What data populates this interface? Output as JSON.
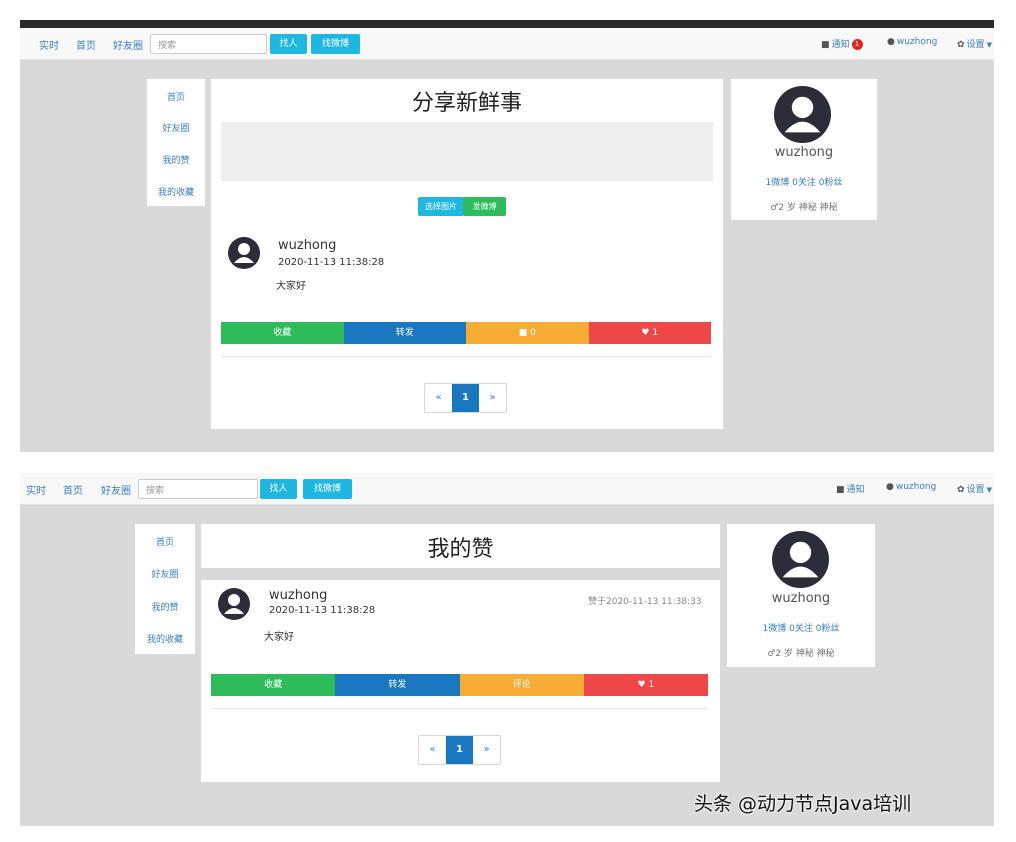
{
  "nav": {
    "realtime": "实时",
    "home": "首页",
    "friends": "好友圈",
    "search_placeholder": "搜索",
    "find_people": "找人",
    "find_weibo": "找微博",
    "notifications": "通知",
    "notification_count": "1",
    "username": "wuzhong",
    "settings": "设置"
  },
  "sidebar": {
    "items": [
      "首页",
      "好友圈",
      "我的赞",
      "我的收藏"
    ]
  },
  "screen1": {
    "title": "分享新鲜事",
    "choose_image": "选择图片",
    "publish": "发微博",
    "post": {
      "user": "wuzhong",
      "time": "2020-11-13 11:38:28",
      "text": "大家好",
      "actions": [
        "收藏",
        "转发",
        "0",
        "1"
      ]
    },
    "pager": {
      "prev": "«",
      "page": "1",
      "next": "»"
    }
  },
  "screen2": {
    "title": "我的赞",
    "post": {
      "user": "wuzhong",
      "time": "2020-11-13 11:38:28",
      "liked_at": "赞于2020-11-13 11:38:33",
      "text": "大家好",
      "actions": [
        "收藏",
        "转发",
        "评论",
        "1"
      ]
    },
    "pager": {
      "prev": "«",
      "page": "1",
      "next": "»"
    }
  },
  "profile": {
    "name": "wuzhong",
    "stats": "1微博 0关注 0粉丝",
    "info": "♂2 岁 神秘 神秘"
  },
  "watermark": "头条 @动力节点Java培训",
  "colors": {
    "accent_cyan": "#1fb6e0",
    "green": "#2dbb5b",
    "blue": "#1877be",
    "orange": "#f6ac33",
    "red": "#ef4747"
  }
}
